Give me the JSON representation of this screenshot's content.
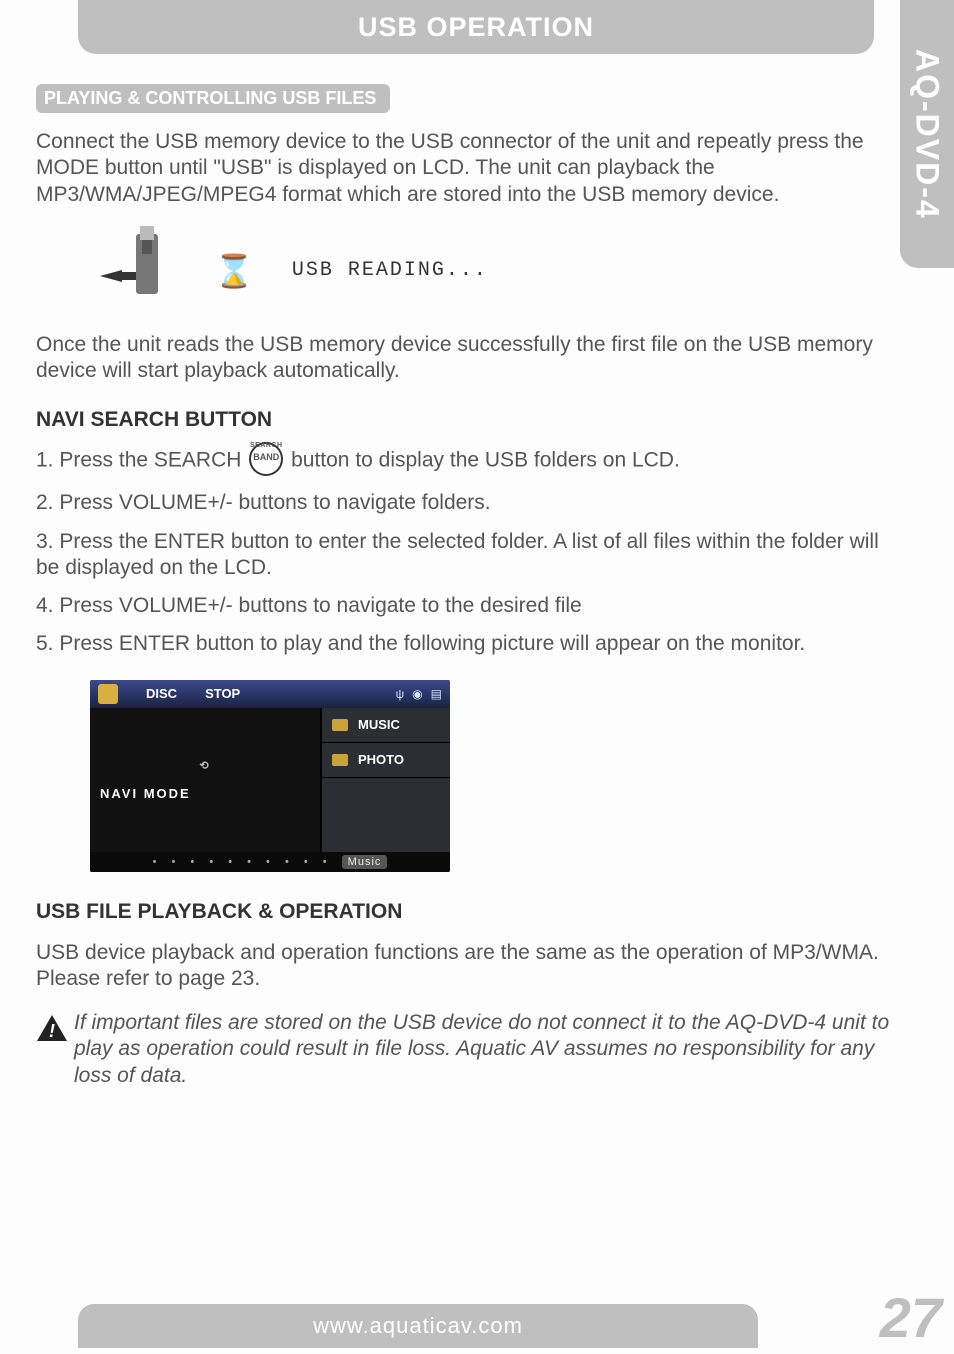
{
  "header": {
    "title": "USB OPERATION"
  },
  "side_tab": "AQ-DVD-4",
  "section1": {
    "title": "PLAYING & CONTROLLING USB FILES",
    "intro": "Connect the USB memory device to the USB connector of the unit and repeatly press the MODE button until \"USB\" is displayed on LCD. The unit can playback the MP3/WMA/JPEG/MPEG4 format which are stored into the USB memory device.",
    "usb_reading_label": "USB READING...",
    "after_read": "Once the unit reads the USB memory device successfully the first file on the USB memory device will start playback automatically."
  },
  "navi": {
    "heading": "NAVI SEARCH BUTTON",
    "step1_a": "1. Press the SEARCH",
    "step1_b": "button to display the USB folders on LCD.",
    "band_label": "BAND",
    "step2": "2. Press VOLUME+/- buttons to navigate folders.",
    "step3": "3. Press the ENTER button to enter the selected folder. A list of all files within the folder will be displayed on the LCD.",
    "step4": "4. Press VOLUME+/- buttons to navigate to the desired file",
    "step5": "5. Press ENTER button to play and the following picture will appear on the monitor."
  },
  "monitor": {
    "disc": "DISC",
    "stop": "STOP",
    "navi_mode": "NAVI MODE",
    "music": "MUSIC",
    "photo": "PHOTO",
    "footer_tag": "Music"
  },
  "playback": {
    "heading": "USB FILE PLAYBACK & OPERATION",
    "body": "USB device playback and operation functions are the same as the operation of MP3/WMA. Please refer to page 23.",
    "warning": "If important files are stored on the USB device do not connect it to the AQ-DVD-4 unit to play as operation could result in file loss. Aquatic AV assumes no responsibility for any loss of data."
  },
  "footer": {
    "url": "www.aquaticav.com",
    "page": "27"
  }
}
